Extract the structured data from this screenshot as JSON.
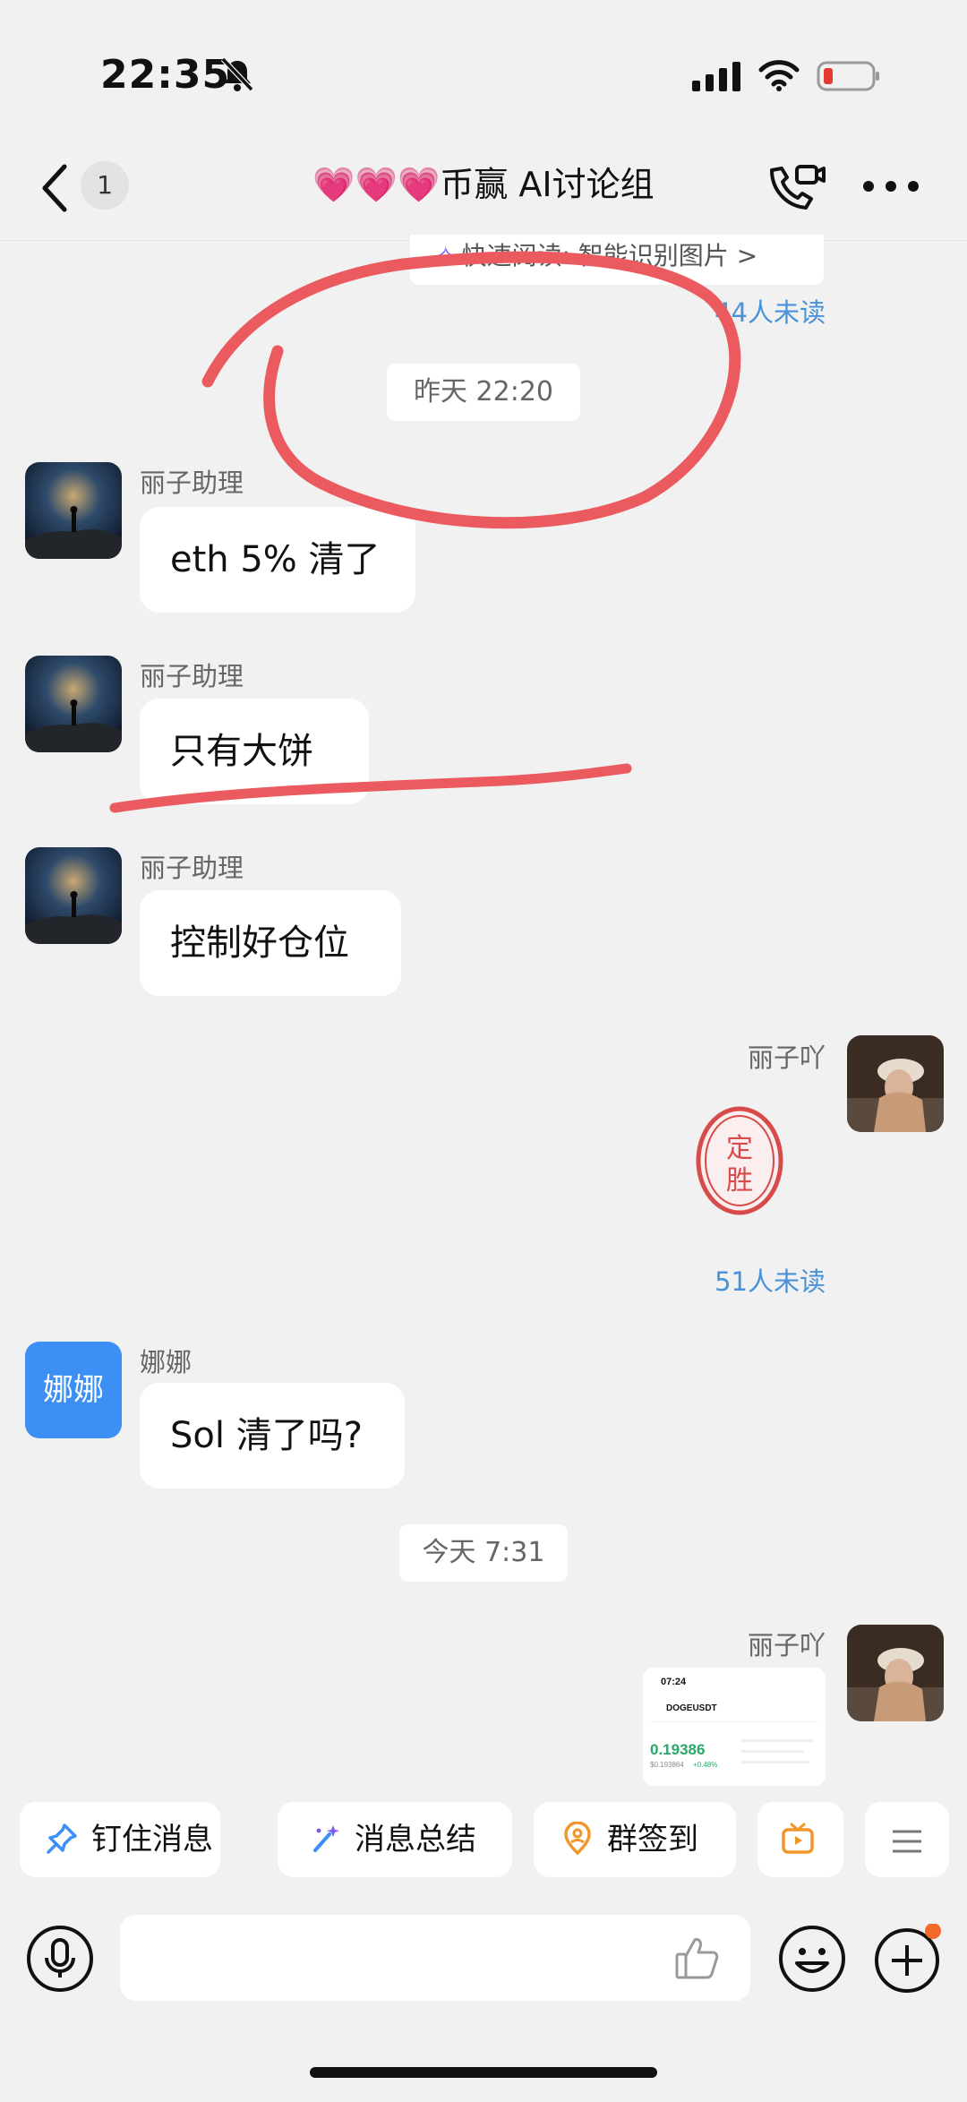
{
  "status_bar": {
    "time": "22:35"
  },
  "header": {
    "unread_badge": "1",
    "title": "💗💗💗币赢 AI讨论组"
  },
  "top_card": {
    "quick_read": "快速阅读: 智能识别图片 >",
    "unread": "44人未读"
  },
  "chat": {
    "time_chip_1": "昨天 22:20",
    "msg1": {
      "sender": "丽子助理",
      "text": "eth 5% 清了"
    },
    "msg2": {
      "sender": "丽子助理",
      "text": "只有大饼"
    },
    "msg3": {
      "sender": "丽子助理",
      "text": "控制好仓位"
    },
    "msg4": {
      "sender": "丽子吖",
      "sticker_text": "定胜",
      "unread": "51人未读"
    },
    "msg5": {
      "sender": "娜娜",
      "avatar_text": "娜娜",
      "text": "Sol 清了吗?"
    },
    "time_chip_2": "今天 7:31",
    "msg6": {
      "sender": "丽子吖",
      "shot": {
        "time": "07:24",
        "symbol": "DOGEUSDT",
        "price": "0.19386",
        "sub1": "$0.193864",
        "sub2": "+0.48%"
      }
    }
  },
  "toolbar": {
    "pin": "钉住消息",
    "summary": "消息总结",
    "checkin": "群签到"
  },
  "colors": {
    "accent_blue": "#3b8ff5",
    "annotation_red": "#ea5a5e",
    "link_blue": "#4a92d8"
  }
}
